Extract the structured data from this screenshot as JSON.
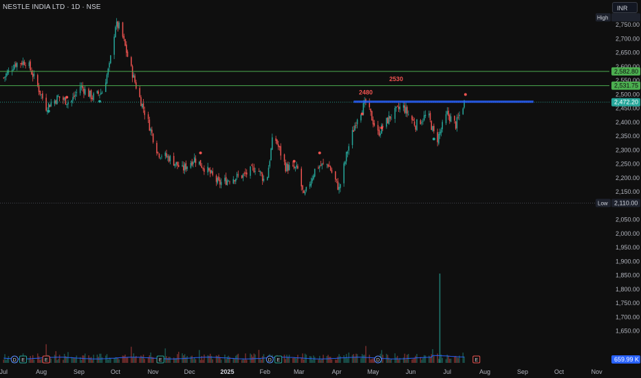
{
  "header": {
    "symbol": "NESTLE INDIA LTD · 1D · NSE",
    "currency": "INR"
  },
  "colors": {
    "background": "#0f0f0f",
    "up": "#26a69a",
    "down": "#ef5350",
    "support_lines": "#4caf50",
    "zone": "#2962ff",
    "volume_line": "#2962ff",
    "marker_up": "#26a69a",
    "marker_down": "#ef5350"
  },
  "chart_data": {
    "type": "candlestick",
    "ylim": [
      1580,
      2790
    ],
    "yticks": [
      2750,
      2700,
      2650,
      2600,
      2550,
      2500,
      2450,
      2400,
      2350,
      2300,
      2250,
      2200,
      2150,
      2050,
      2000,
      1950,
      1900,
      1850,
      1800,
      1750,
      1700,
      1650
    ],
    "ytick_labels": [
      "2,750.00",
      "2,700.00",
      "2,650.00",
      "2,600.00",
      "2,550.00",
      "2,500.00",
      "2,450.00",
      "2,400.00",
      "2,350.00",
      "2,300.00",
      "2,250.00",
      "2,200.00",
      "2,150.00",
      "2,050.00",
      "2,000.00",
      "1,950.00",
      "1,900.00",
      "1,850.00",
      "1,800.00",
      "1,750.00",
      "1,700.00",
      "1,650.00"
    ],
    "xaxis_labels": [
      "Jul",
      "Aug",
      "Sep",
      "Oct",
      "Nov",
      "Dec",
      "2025",
      "Feb",
      "Mar",
      "Apr",
      "May",
      "Jun",
      "Jul",
      "Aug",
      "Sep",
      "Oct",
      "Nov"
    ],
    "horizontal_lines": [
      {
        "value": 2582.8,
        "label": "2,582.80"
      },
      {
        "value": 2531.75,
        "label": "2,531.75"
      }
    ],
    "price_line": {
      "value": 2472.2,
      "label": "2,472.20"
    },
    "high": {
      "tag": "High",
      "value": 2777
    },
    "low": {
      "tag": "Low",
      "value": 2110,
      "label": "2,110.00"
    },
    "resistance_zone": {
      "from": 2470,
      "to": 2478
    },
    "annotations": [
      {
        "text": "2480",
        "x": "2025-04-25",
        "y": 2500
      },
      {
        "text": "2530",
        "x": "2025-05-20",
        "y": 2548
      }
    ],
    "volume": {
      "label": "659.99 K",
      "spike_month": "Jun 2025"
    },
    "event_markers": [
      "D",
      "E",
      "E",
      "E",
      "D",
      "E",
      "D",
      "E"
    ],
    "price_path": [
      [
        "2024-07-01",
        2560
      ],
      [
        "2024-07-10",
        2610
      ],
      [
        "2024-07-20",
        2620
      ],
      [
        "2024-07-28",
        2540
      ],
      [
        "2024-08-05",
        2455
      ],
      [
        "2024-08-15",
        2490
      ],
      [
        "2024-08-25",
        2470
      ],
      [
        "2024-09-02",
        2530
      ],
      [
        "2024-09-12",
        2490
      ],
      [
        "2024-09-20",
        2510
      ],
      [
        "2024-09-26",
        2600
      ],
      [
        "2024-10-01",
        2750
      ],
      [
        "2024-10-05",
        2740
      ],
      [
        "2024-10-12",
        2620
      ],
      [
        "2024-10-20",
        2500
      ],
      [
        "2024-10-28",
        2400
      ],
      [
        "2024-11-05",
        2290
      ],
      [
        "2024-11-15",
        2270
      ],
      [
        "2024-11-25",
        2230
      ],
      [
        "2024-12-05",
        2270
      ],
      [
        "2024-12-15",
        2230
      ],
      [
        "2024-12-25",
        2180
      ],
      [
        "2025-01-05",
        2200
      ],
      [
        "2025-01-15",
        2210
      ],
      [
        "2025-01-25",
        2240
      ],
      [
        "2025-02-02",
        2180
      ],
      [
        "2025-02-08",
        2360
      ],
      [
        "2025-02-18",
        2240
      ],
      [
        "2025-02-28",
        2230
      ],
      [
        "2025-03-05",
        2130
      ],
      [
        "2025-03-15",
        2240
      ],
      [
        "2025-03-25",
        2250
      ],
      [
        "2025-04-03",
        2160
      ],
      [
        "2025-04-10",
        2300
      ],
      [
        "2025-04-18",
        2420
      ],
      [
        "2025-04-25",
        2470
      ],
      [
        "2025-05-05",
        2360
      ],
      [
        "2025-05-15",
        2420
      ],
      [
        "2025-05-25",
        2460
      ],
      [
        "2025-06-05",
        2390
      ],
      [
        "2025-06-15",
        2430
      ],
      [
        "2025-06-22",
        2330
      ],
      [
        "2025-07-01",
        2430
      ],
      [
        "2025-07-08",
        2390
      ],
      [
        "2025-07-15",
        2472
      ]
    ],
    "markers": [
      {
        "x": "2024-08-07",
        "y": 2440,
        "side": "below"
      },
      {
        "x": "2024-08-22",
        "y": 2490,
        "side": "above"
      },
      {
        "x": "2024-09-18",
        "y": 2475,
        "side": "below"
      },
      {
        "x": "2024-12-10",
        "y": 2290,
        "side": "above"
      },
      {
        "x": "2025-02-25",
        "y": 2260,
        "side": "above"
      },
      {
        "x": "2025-03-18",
        "y": 2290,
        "side": "above"
      },
      {
        "x": "2025-04-22",
        "y": 2430,
        "side": "above"
      },
      {
        "x": "2025-05-08",
        "y": 2380,
        "side": "above"
      },
      {
        "x": "2025-06-20",
        "y": 2340,
        "side": "below"
      },
      {
        "x": "2025-07-16",
        "y": 2500,
        "side": "above"
      }
    ]
  }
}
